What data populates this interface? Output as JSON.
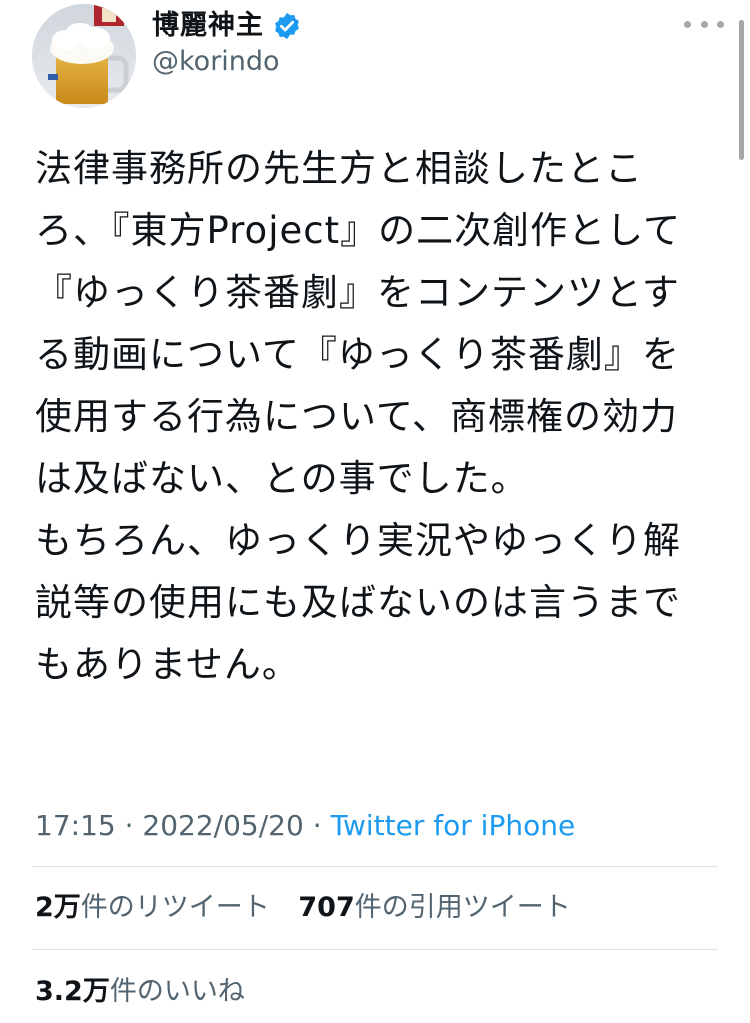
{
  "author": {
    "display_name": "博麗神主",
    "handle": "@korindo",
    "verified": true,
    "avatar_icon": "beer-mug-avatar"
  },
  "more_menu_icon": "more-dots-icon",
  "tweet": {
    "text": "法律事務所の先生方と相談したところ、『東方Project』の二次創作として『ゆっくり茶番劇』をコンテンツとする動画について『ゆっくり茶番劇』を使用する行為について、商標権の効力は及ばない、との事でした。\nもちろん、ゆっくり実況やゆっくり解説等の使用にも及ばないのは言うまでもありません。",
    "time": "17:15",
    "separator": "·",
    "date": "2022/05/20",
    "source": "Twitter for iPhone"
  },
  "stats": {
    "retweets_count": "2万",
    "retweets_label": "件のリツイート",
    "quotes_count": "707",
    "quotes_label": "件の引用ツイート",
    "likes_count": "3.2万",
    "likes_label": "件のいいね"
  },
  "colors": {
    "link": "#1d9bf0",
    "secondary_text": "#536471",
    "verified_badge": "#1d9bf0"
  }
}
